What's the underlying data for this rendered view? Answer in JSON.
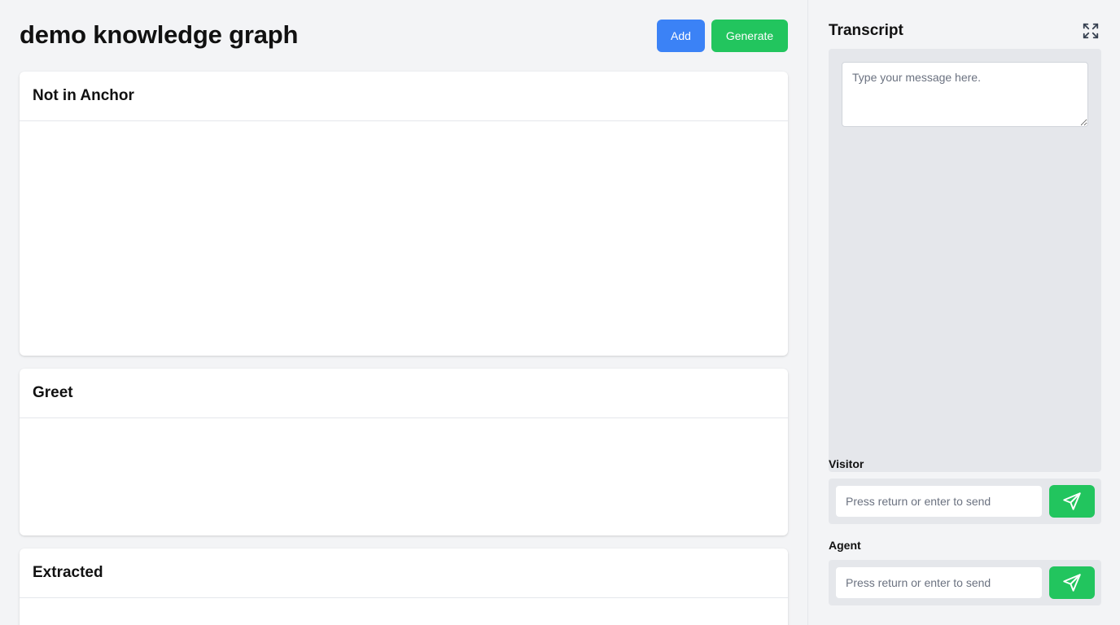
{
  "header": {
    "title": "demo knowledge graph",
    "add_label": "Add",
    "generate_label": "Generate"
  },
  "sections": [
    {
      "title": "Not in Anchor"
    },
    {
      "title": "Greet"
    },
    {
      "title": "Extracted"
    }
  ],
  "sidebar": {
    "title": "Transcript",
    "expand_icon": "expand-icon",
    "message_placeholder": "Type your message here.",
    "visitor": {
      "label": "Visitor",
      "placeholder": "Press return or enter to send",
      "send_icon": "send-icon"
    },
    "agent": {
      "label": "Agent",
      "placeholder": "Press return or enter to send",
      "send_icon": "send-icon"
    }
  },
  "colors": {
    "add_button": "#3b82f6",
    "generate_button": "#22c55e",
    "send_button": "#22c55e",
    "background": "#f3f4f6",
    "panel": "#e5e7eb"
  }
}
